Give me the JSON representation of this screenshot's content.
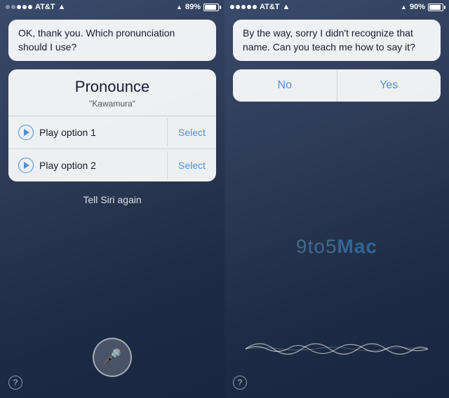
{
  "left": {
    "statusBar": {
      "carrier": "AT&T",
      "signal_dots": [
        false,
        false,
        true,
        true,
        true
      ],
      "battery_pct": "89%",
      "battery_level": 89
    },
    "siri_text": "OK, thank you. Which pronunciation should I use?",
    "pronounce_card": {
      "title": "Pronounce",
      "subtitle": "\"Kawamura\"",
      "options": [
        {
          "label": "Play option 1",
          "select_label": "Select"
        },
        {
          "label": "Play option 2",
          "select_label": "Select"
        }
      ]
    },
    "tell_again": "Tell Siri again",
    "help_label": "?"
  },
  "right": {
    "statusBar": {
      "carrier": "AT&T",
      "signal_dots": [
        true,
        true,
        true,
        true,
        true
      ],
      "battery_pct": "90%",
      "battery_level": 90
    },
    "siri_text": "By the way, sorry I didn't recognize that name. Can you teach me how to say it?",
    "no_label": "No",
    "yes_label": "Yes",
    "watermark": "9to5Mac",
    "help_label": "?"
  }
}
